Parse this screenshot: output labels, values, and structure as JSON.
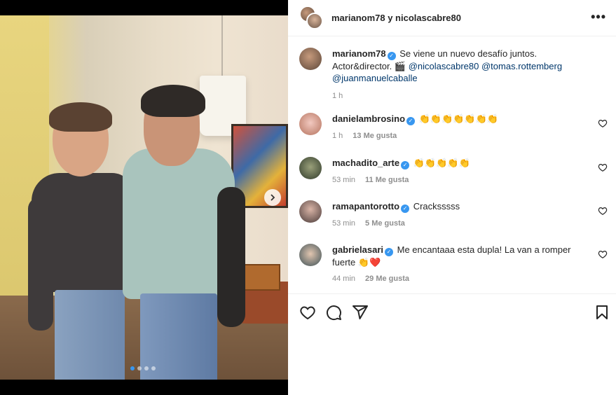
{
  "post": {
    "header_title": "marianom78 y nicolascabre80",
    "more_icon": "more-horizontal-icon"
  },
  "caption": {
    "username": "marianom78",
    "text_line1": "Se viene un nuevo desafío juntos.",
    "text_line2_prefix": "Actor&director.",
    "emoji": "🎬",
    "mention1": "@nicolascabre80",
    "mention2": "@tomas.rottemberg",
    "mention3": "@juanmanuelcaballe",
    "time": "1 h"
  },
  "comments": [
    {
      "username": "danielambrosino",
      "text": "👏👏👏👏👏👏👏",
      "time": "1 h",
      "likes": "13 Me gusta"
    },
    {
      "username": "machadito_arte",
      "text": "👏👏👏👏👏",
      "time": "53 min",
      "likes": "11 Me gusta"
    },
    {
      "username": "ramapantorotto",
      "text": "Cracksssss",
      "time": "53 min",
      "likes": "5 Me gusta"
    },
    {
      "username": "gabrielasari",
      "text": "Me encantaaa esta dupla! La van a romper fuerte 👏❤️",
      "time": "44 min",
      "likes": "29 Me gusta"
    }
  ],
  "carousel": {
    "dots": 4,
    "active_index": 0
  },
  "colors": {
    "verified": "#3897f0",
    "mention": "#00376b",
    "secondary": "#8e8e8e"
  }
}
